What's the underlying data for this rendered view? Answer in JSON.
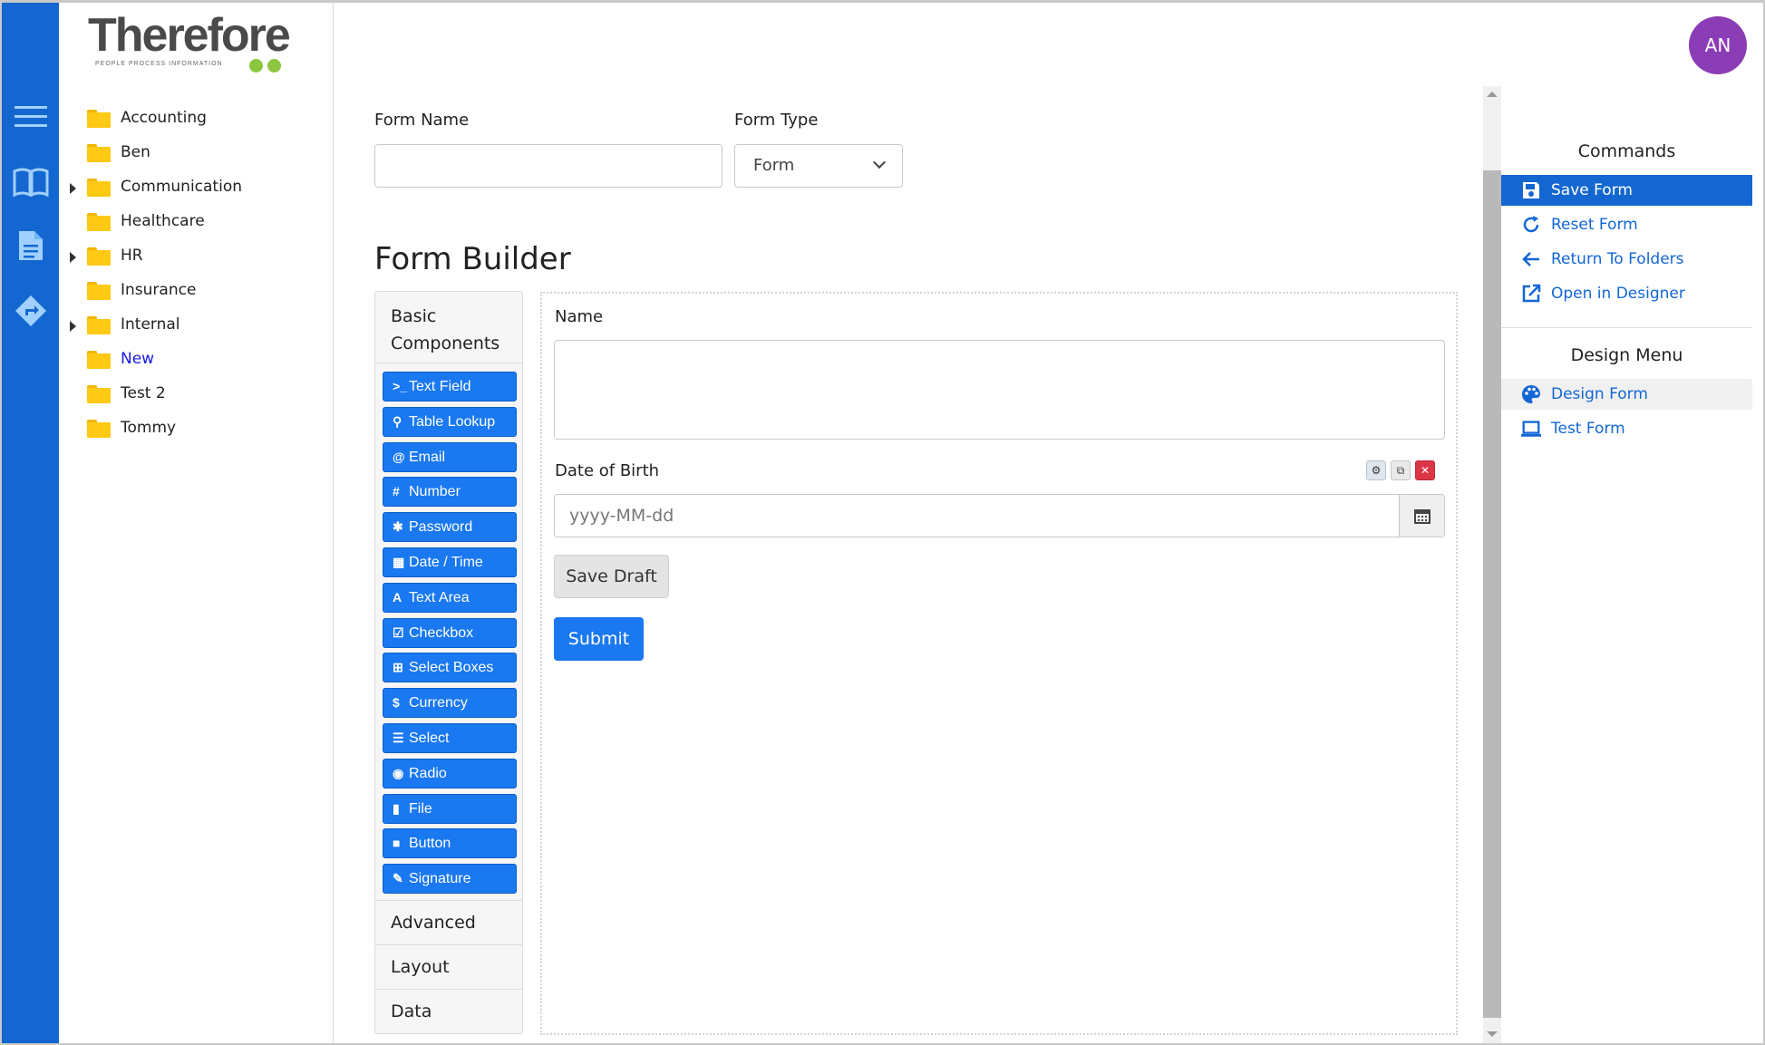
{
  "app": {
    "logo_text": "Therefore",
    "logo_tagline": "PEOPLE  PROCESS  INFORMATION",
    "user_initials": "AN",
    "accent_color": "#1467d0",
    "avatar_color": "#8b3db5"
  },
  "rail": {
    "icons": [
      "menu-icon",
      "book-icon",
      "document-icon",
      "workflow-icon"
    ]
  },
  "tree": {
    "items": [
      {
        "label": "Accounting",
        "expandable": false,
        "active": false
      },
      {
        "label": "Ben",
        "expandable": false,
        "active": false
      },
      {
        "label": "Communication",
        "expandable": true,
        "active": false
      },
      {
        "label": "Healthcare",
        "expandable": false,
        "active": false
      },
      {
        "label": "HR",
        "expandable": true,
        "active": false
      },
      {
        "label": "Insurance",
        "expandable": false,
        "active": false
      },
      {
        "label": "Internal",
        "expandable": true,
        "active": false
      },
      {
        "label": "New",
        "expandable": false,
        "active": true
      },
      {
        "label": "Test 2",
        "expandable": false,
        "active": false
      },
      {
        "label": "Tommy",
        "expandable": false,
        "active": false
      }
    ]
  },
  "form": {
    "name_label": "Form Name",
    "name_value": "",
    "type_label": "Form Type",
    "type_value": "Form"
  },
  "builder": {
    "title": "Form Builder",
    "palette_header": "Basic Components",
    "components": [
      {
        "label": "Text Field",
        "icon": ">_"
      },
      {
        "label": "Table Lookup",
        "icon": "⚲"
      },
      {
        "label": "Email",
        "icon": "@"
      },
      {
        "label": "Number",
        "icon": "#"
      },
      {
        "label": "Password",
        "icon": "✱"
      },
      {
        "label": "Date / Time",
        "icon": "▦"
      },
      {
        "label": "Text Area",
        "icon": "A"
      },
      {
        "label": "Checkbox",
        "icon": "☑"
      },
      {
        "label": "Select Boxes",
        "icon": "⊞"
      },
      {
        "label": "Currency",
        "icon": "$"
      },
      {
        "label": "Select",
        "icon": "☰"
      },
      {
        "label": "Radio",
        "icon": "◉"
      },
      {
        "label": "File",
        "icon": "▮"
      },
      {
        "label": "Button",
        "icon": "■"
      },
      {
        "label": "Signature",
        "icon": "✎"
      }
    ],
    "sections": [
      "Advanced",
      "Layout",
      "Data"
    ],
    "canvas": {
      "name_label": "Name",
      "dob_label": "Date of Birth",
      "dob_placeholder": "yyyy-MM-dd",
      "save_draft_label": "Save Draft",
      "submit_label": "Submit"
    }
  },
  "commands": {
    "header": "Commands",
    "items": [
      {
        "label": "Save Form",
        "icon": "save-icon"
      },
      {
        "label": "Reset Form",
        "icon": "reset-icon"
      },
      {
        "label": "Return To Folders",
        "icon": "arrow-left-icon"
      },
      {
        "label": "Open in Designer",
        "icon": "external-link-icon"
      }
    ]
  },
  "design_menu": {
    "header": "Design Menu",
    "items": [
      {
        "label": "Design Form",
        "icon": "palette-icon"
      },
      {
        "label": "Test Form",
        "icon": "laptop-icon"
      }
    ]
  }
}
